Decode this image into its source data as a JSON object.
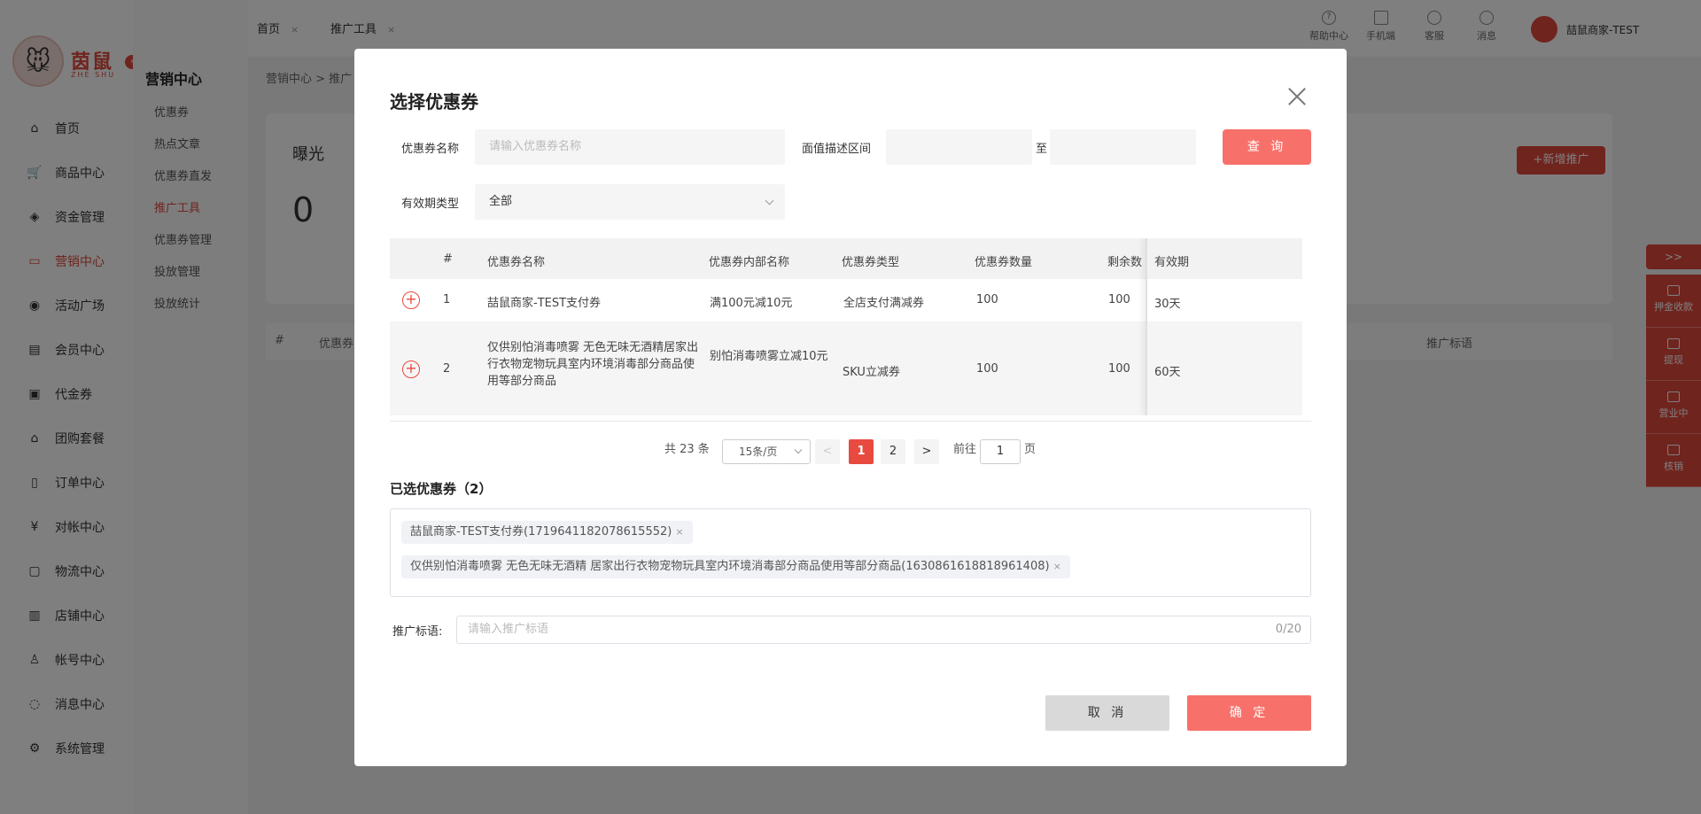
{
  "app": {
    "logo_text": "茵鼠",
    "logo_sub": "ZHE SHU",
    "nav": [
      {
        "label": "首页",
        "icon": "home-icon"
      },
      {
        "label": "商品中心",
        "icon": "cart-icon"
      },
      {
        "label": "资金管理",
        "icon": "layers-icon"
      },
      {
        "label": "营销中心",
        "icon": "marketing-icon",
        "active": true
      },
      {
        "label": "活动广场",
        "icon": "activity-icon"
      },
      {
        "label": "会员中心",
        "icon": "vip-icon"
      },
      {
        "label": "代金券",
        "icon": "voucher-icon"
      },
      {
        "label": "团购套餐",
        "icon": "group-buy-icon"
      },
      {
        "label": "订单中心",
        "icon": "order-icon"
      },
      {
        "label": "对帐中心",
        "icon": "yen-icon"
      },
      {
        "label": "物流中心",
        "icon": "box-icon"
      },
      {
        "label": "店铺中心",
        "icon": "store-icon"
      },
      {
        "label": "帐号中心",
        "icon": "user-icon"
      },
      {
        "label": "消息中心",
        "icon": "chat-icon"
      },
      {
        "label": "系统管理",
        "icon": "settings-icon"
      }
    ],
    "subnav_title": "营销中心",
    "subnav": [
      "优惠券",
      "热点文章",
      "优惠券直发",
      "推广工具",
      "优惠券管理",
      "投放管理",
      "投放统计"
    ],
    "tabs": [
      {
        "label": "首页"
      },
      {
        "label": "推广工具"
      }
    ],
    "tab_close": "×",
    "tools": [
      {
        "label": "帮助中心",
        "icon": "help-icon"
      },
      {
        "label": "手机端",
        "icon": "mobile-icon"
      },
      {
        "label": "客服",
        "icon": "headset-icon"
      },
      {
        "label": "消息",
        "icon": "message-icon"
      }
    ],
    "user_name": "喆鼠商家-TEST",
    "breadcrumb": "营销中心 > 推广",
    "stat_label": "曝光",
    "stat_value": "0",
    "new_promo_button": "+新增推广",
    "bg_columns": {
      "index": "#",
      "name": "优惠券",
      "slogan": "推广标语"
    },
    "right_toggle": ">>",
    "right_items": [
      "押金收款",
      "提现",
      "营业中",
      "核销"
    ],
    "accent_color": "#e0493c"
  },
  "modal": {
    "title": "选择优惠券",
    "filters": {
      "name_label": "优惠券名称",
      "name_placeholder": "请输入优惠券名称",
      "range_label": "面值描述区间",
      "range_sep": "至",
      "query_button": "查 询",
      "validity_label": "有效期类型",
      "validity_value": "全部"
    },
    "table": {
      "columns": [
        "#",
        "优惠券名称",
        "优惠券内部名称",
        "优惠券类型",
        "优惠券数量",
        "剩余数",
        "有效期"
      ],
      "rows": [
        {
          "index": "1",
          "name": "喆鼠商家-TEST支付券",
          "internal": "满100元减10元",
          "type": "全店支付满减券",
          "count": "100",
          "remaining": "100",
          "validity": "30天"
        },
        {
          "index": "2",
          "name": "仅供别怕消毒喷雾 无色无味无酒精居家出行衣物宠物玩具室内环境消毒部分商品使用等部分商品",
          "internal": "别怕消毒喷雾立减10元",
          "type": "SKU立减券",
          "count": "100",
          "remaining": "100",
          "validity": "60天"
        }
      ]
    },
    "pager": {
      "total": "共 23 条",
      "page_size": "15条/页",
      "prev": "<",
      "pages": [
        "1",
        "2"
      ],
      "current_page": 1,
      "next": ">",
      "goto_label": "前往",
      "goto_value": "1",
      "goto_suffix": "页"
    },
    "selected": {
      "title": "已选优惠券（2）",
      "tags": [
        "喆鼠商家-TEST支付券(1719641182078615552)",
        "仅供别怕消毒喷雾 无色无味无酒精 居家出行衣物宠物玩具室内环境消毒部分商品使用等部分商品(1630861618818961408)"
      ],
      "remove": "×"
    },
    "slogan": {
      "label": "推广标语:",
      "placeholder": "请输入推广标语",
      "counter": "0/20"
    },
    "cancel_button": "取 消",
    "confirm_button": "确 定",
    "accent_color": "#f7716a"
  }
}
